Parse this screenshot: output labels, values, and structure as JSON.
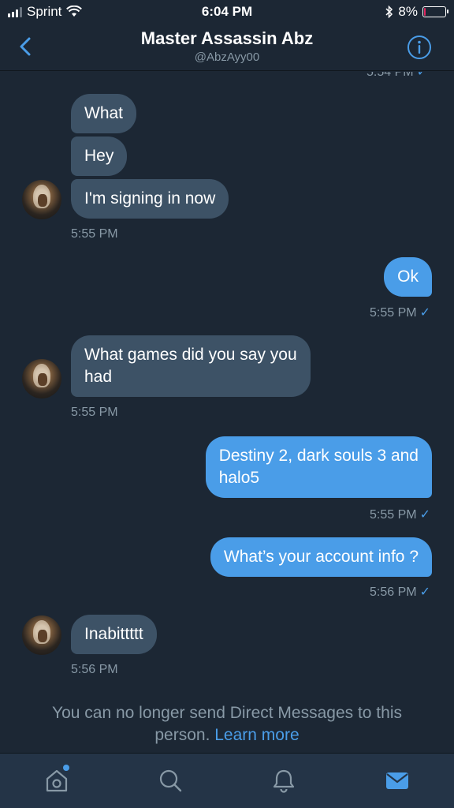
{
  "status_bar": {
    "carrier": "Sprint",
    "time": "6:04 PM",
    "battery": "8%",
    "battery_level": 0.08,
    "icons": [
      "signal-icon",
      "wifi-icon",
      "bluetooth-icon",
      "battery-icon"
    ]
  },
  "header": {
    "name": "Master Assassin Abz",
    "handle": "@AbzAyy00",
    "back_icon": "chevron-left-icon",
    "info_icon": "info-icon"
  },
  "chat": {
    "cut_timestamp": "5:54 PM",
    "group1": {
      "messages": [
        "What",
        "Hey",
        "I'm signing in now"
      ],
      "time": "5:55 PM"
    },
    "msg_ok": {
      "text": "Ok",
      "time": "5:55 PM"
    },
    "msg_games": {
      "line1": "What games did you say you",
      "line2": "had",
      "time": "5:55 PM"
    },
    "msg_destiny": {
      "line1": "Destiny 2, dark souls 3 and",
      "line2": "halo5",
      "time": "5:55 PM"
    },
    "msg_account": {
      "text": "What’s your account info ?",
      "time": "5:56 PM"
    },
    "msg_inabit": {
      "text": "Inabittttt",
      "time": "5:56 PM"
    },
    "read_mark": "✓"
  },
  "notice": {
    "line1": "You can no longer send Direct Messages to this",
    "line2_prefix": "person.",
    "link": "Learn more"
  },
  "tabbar": {
    "tabs": [
      "home-icon",
      "search-icon",
      "notifications-icon",
      "messages-icon"
    ],
    "active": "messages-icon"
  },
  "colors": {
    "background": "#1c2734",
    "incoming_bubble": "#3d5266",
    "outgoing_bubble": "#4a9de8",
    "secondary_text": "#8899a6",
    "accent": "#4a9de8"
  }
}
